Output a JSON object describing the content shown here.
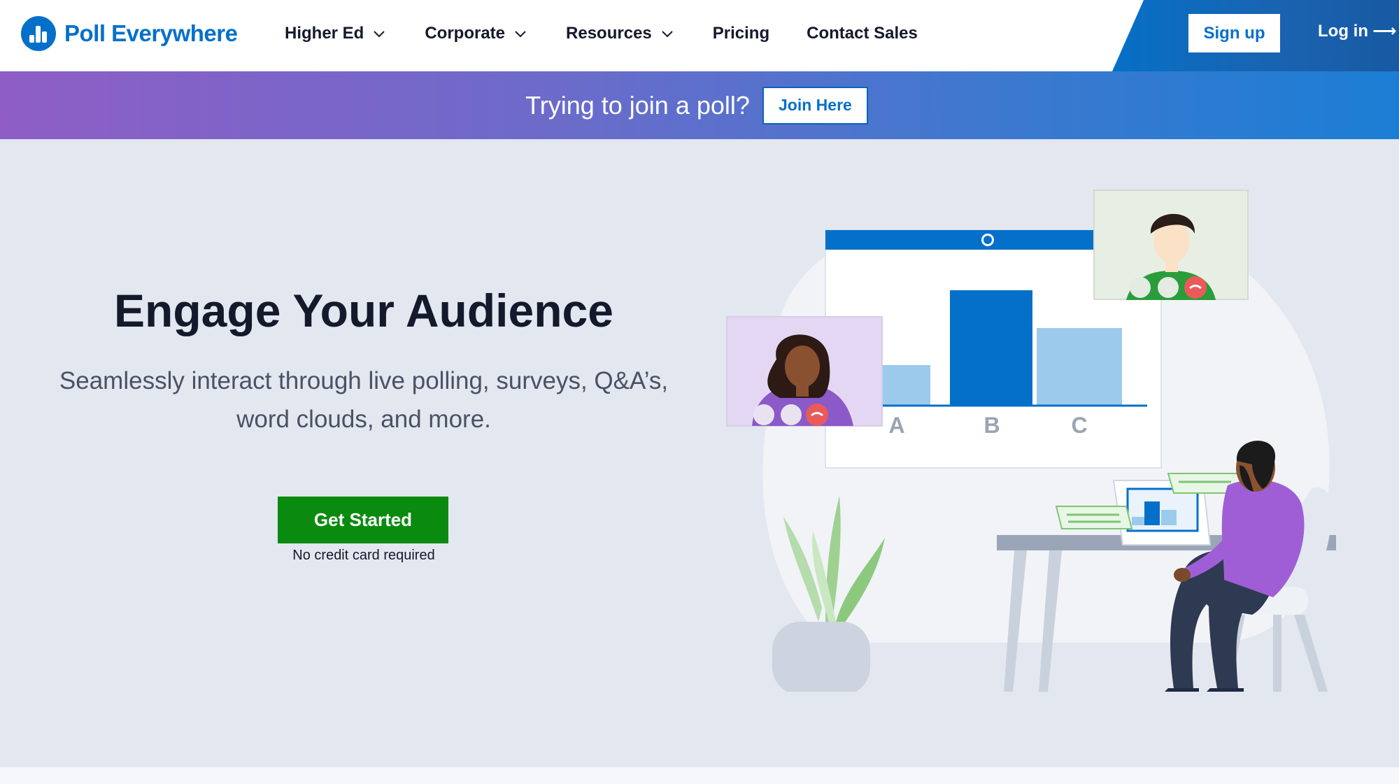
{
  "header": {
    "logo_text": "Poll Everywhere",
    "nav": [
      {
        "label": "Higher Ed",
        "has_dropdown": true
      },
      {
        "label": "Corporate",
        "has_dropdown": true
      },
      {
        "label": "Resources",
        "has_dropdown": true
      },
      {
        "label": "Pricing",
        "has_dropdown": false
      },
      {
        "label": "Contact Sales",
        "has_dropdown": false
      }
    ],
    "signup_label": "Sign up",
    "login_label": "Log in",
    "login_arrow": "⟶"
  },
  "banner": {
    "text": "Trying to join a poll?",
    "button_label": "Join Here"
  },
  "hero": {
    "title": "Engage Your Audience",
    "subtitle_line1": "Seamlessly interact through live polling, surveys, Q&A’s,",
    "subtitle_line2": "word clouds, and more.",
    "cta_label": "Get Started",
    "cta_note": "No credit card required"
  },
  "illustration": {
    "poll_labels": [
      "A",
      "B",
      "C"
    ]
  },
  "colors": {
    "brand_blue": "#0570c9",
    "cta_green": "#0b8a10",
    "hero_bg": "#e3e7ef"
  },
  "icons": {
    "nav_dropdown": "chevron-down-icon",
    "login": "arrow-right-icon",
    "logo": "poll-everywhere-logo-icon"
  }
}
